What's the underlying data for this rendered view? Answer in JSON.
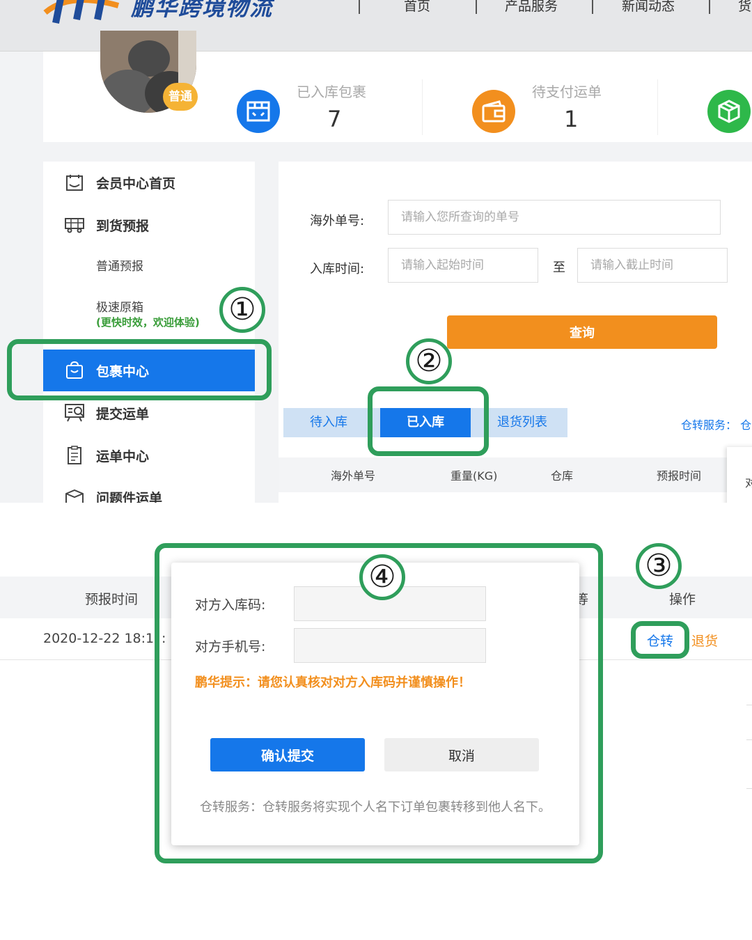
{
  "header": {
    "logo_text": "鹏华跨境物流",
    "nav": [
      "首页",
      "产品服务",
      "新闻动态",
      "货"
    ]
  },
  "profile": {
    "badge": "普通"
  },
  "stats": [
    {
      "label": "已入库包裹",
      "value": "7",
      "color": "#1577ea",
      "icon": "package-box-icon"
    },
    {
      "label": "待支付运单",
      "value": "1",
      "color": "#f28f1e",
      "icon": "wallet-icon"
    },
    {
      "label": "",
      "value": "",
      "color": "#2eb84a",
      "icon": "cube-icon"
    }
  ],
  "sidebar": {
    "items": [
      {
        "label": "会员中心首页",
        "icon": "member-home-icon"
      },
      {
        "label": "到货预报",
        "icon": "truck-icon"
      },
      {
        "label": "普通预报"
      },
      {
        "label": "极速原箱",
        "note": "(更快时效，欢迎体验)"
      },
      {
        "label": "包裹中心",
        "icon": "bag-icon"
      },
      {
        "label": "提交运单",
        "icon": "submit-order-icon"
      },
      {
        "label": "运单中心",
        "icon": "clipboard-icon"
      },
      {
        "label": "问题件运单",
        "icon": "problem-package-icon"
      }
    ]
  },
  "search": {
    "overseas_label": "海外单号:",
    "overseas_placeholder": "请输入您所查询的单号",
    "time_label": "入库时间:",
    "start_placeholder": "请输入起始时间",
    "to": "至",
    "end_placeholder": "请输入截止时间",
    "query_button": "查询"
  },
  "tabs": [
    "待入库",
    "已入库",
    "退货列表"
  ],
  "transfer_link": "仓转服务： 仓",
  "table_top": {
    "headers": [
      "海外单号",
      "重量(KG)",
      "仓库",
      "预报时间",
      "对"
    ]
  },
  "table_bottom": {
    "headers": [
      "预报时间",
      "等",
      "操作"
    ],
    "row": {
      "time": "2020-12-22 18:1",
      "time_tail": ":",
      "action_transfer": "仓转",
      "action_return": "退货"
    }
  },
  "modal": {
    "code_label": "对方入库码:",
    "phone_label": "对方手机号:",
    "tip": "鹏华提示：请您认真核对对方入库码并谨慎操作！",
    "confirm": "确认提交",
    "cancel": "取消",
    "footer": "仓转服务：仓转服务将实现个人名下订单包裹转移到他人名下。"
  },
  "annotations": [
    "①",
    "②",
    "③",
    "④"
  ],
  "colors": {
    "primary": "#1577ea",
    "orange": "#f28f1e",
    "highlight": "#2f9e5b"
  }
}
